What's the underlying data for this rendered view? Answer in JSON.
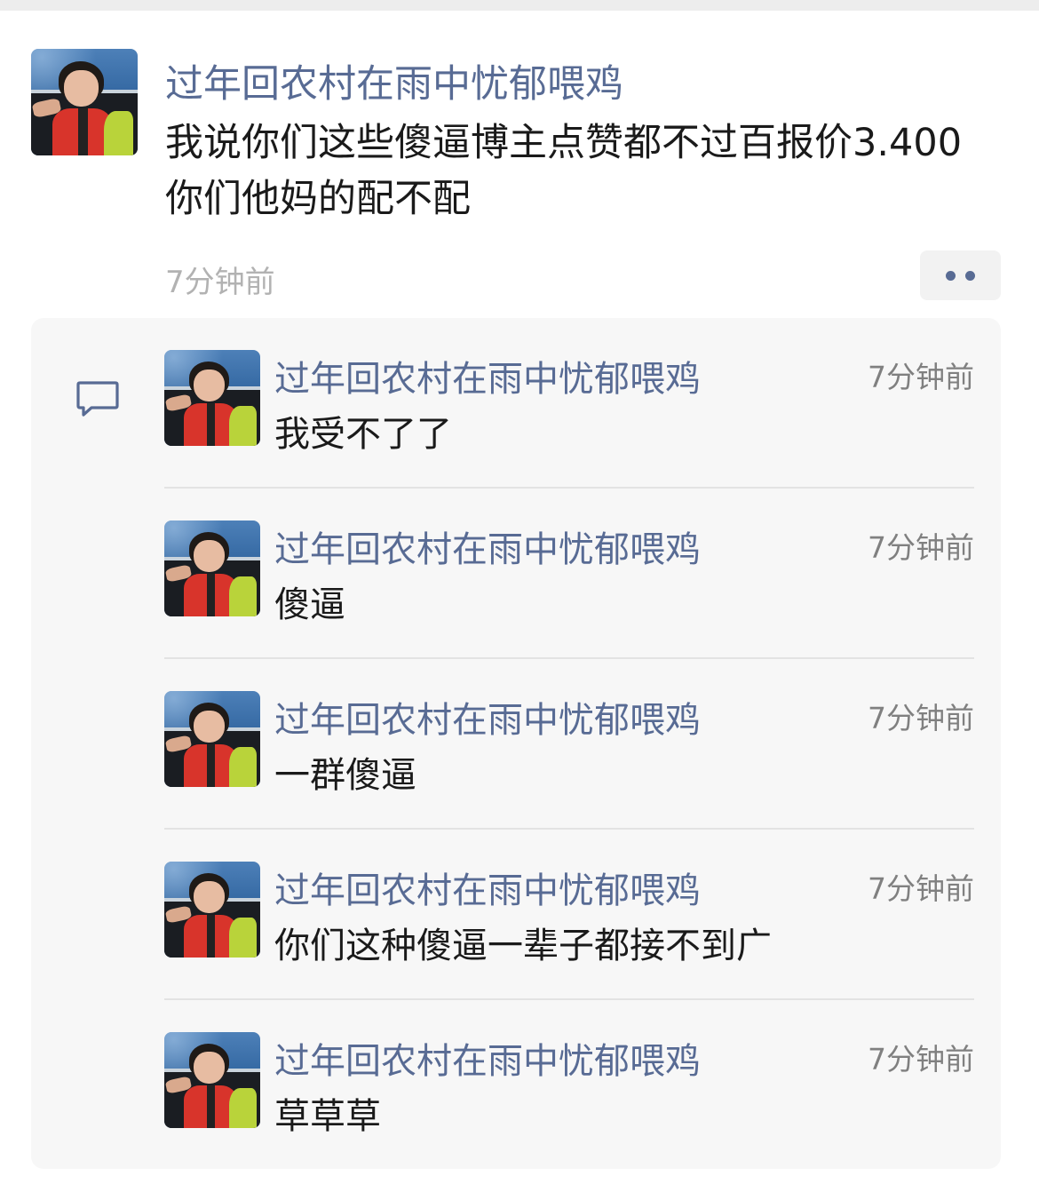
{
  "post": {
    "author": "过年回农村在雨中忧郁喂鸡",
    "text": "我说你们这些傻逼博主点赞都不过百报价3.400你们他妈的配不配",
    "time": "7分钟前",
    "more_icon": "more-dots-icon",
    "author_color": "#586b94"
  },
  "comments_icon": "comment-bubble-icon",
  "comments": [
    {
      "author": "过年回农村在雨中忧郁喂鸡",
      "time": "7分钟前",
      "text": "我受不了了"
    },
    {
      "author": "过年回农村在雨中忧郁喂鸡",
      "time": "7分钟前",
      "text": "傻逼"
    },
    {
      "author": "过年回农村在雨中忧郁喂鸡",
      "time": "7分钟前",
      "text": "一群傻逼"
    },
    {
      "author": "过年回农村在雨中忧郁喂鸡",
      "time": "7分钟前",
      "text": "你们这种傻逼一辈子都接不到广"
    },
    {
      "author": "过年回农村在雨中忧郁喂鸡",
      "time": "7分钟前",
      "text": "草草草"
    }
  ]
}
